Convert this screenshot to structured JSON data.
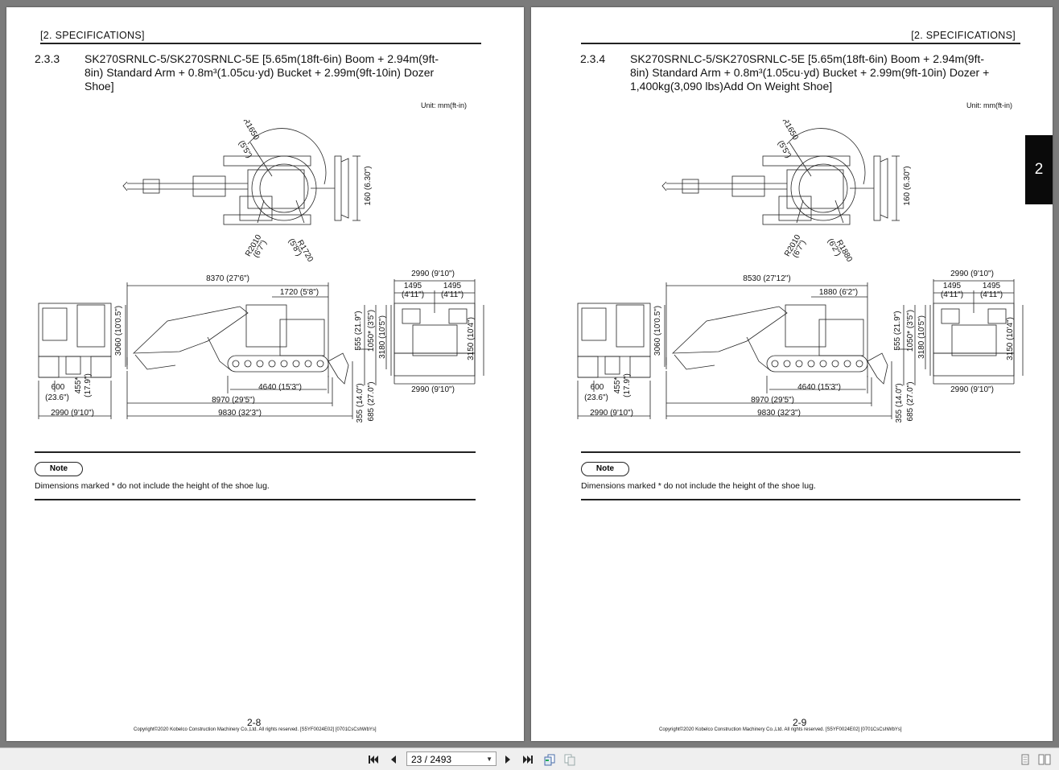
{
  "pages": [
    {
      "header": "[2.   SPECIFICATIONS]",
      "section_number": "2.3.3",
      "title_lines": [
        "SK270SRNLC-5/SK270SRNLC-5E [5.65m(18ft-6in) Boom + 2.94m(9ft-",
        "8in) Standard Arm + 0.8m³(1.05cu·yd) Bucket + 2.99m(9ft-10in) Dozer",
        "Shoe]"
      ],
      "unit": "Unit: mm(ft-in)",
      "dims": {
        "r_top": "R1650",
        "r_top_ft": "(5'5\")",
        "w160": "160 (6.30\")",
        "r_left": "R2010",
        "r_left_ft": "(6'7\")",
        "r_right": "R1720",
        "r_right_ft": "(5'8\")",
        "overall_len": "8370 (27'6\")",
        "tail": "1720 (5'8\")",
        "h3060": "3060 (10'0.5\")",
        "h555": "555 (21.9\")",
        "h1050": "1050* (3'5\")",
        "h3180": "3180 (10'5\")",
        "track_len": "4640 (15'3\")",
        "len8970": "8970 (29'5\")",
        "len9830": "9830 (32'3\")",
        "d355": "355 (14.0\")",
        "d685": "685 (27.0\")",
        "w600": "600",
        "w600_in": "(23.6\")",
        "h455": "455*",
        "h455_in": "(17.9\")",
        "width_bottom": "2990 (9'10\")",
        "rear_width_top": "2990 (9'10\")",
        "w1495a": "1495",
        "w1495a_ft": "(4'11\")",
        "w1495b": "1495",
        "w1495b_ft": "(4'11\")",
        "h3150": "3150 (10'4\")",
        "rear_width_bottom": "2990 (9'10\")"
      },
      "note_label": "Note",
      "note_text": "Dimensions marked * do not include the height of the shoe lug.",
      "page_number": "2-8",
      "copyright": "Copyright©2020 Kobelco Construction Machinery Co.,Ltd. All rights reserved. [S5YF0024E02] [0701CsCshWbYs]"
    },
    {
      "header": "[2.   SPECIFICATIONS]",
      "section_number": "2.3.4",
      "title_lines": [
        "SK270SRNLC-5/SK270SRNLC-5E [5.65m(18ft-6in) Boom + 2.94m(9ft-",
        "8in) Standard Arm + 0.8m³(1.05cu·yd) Bucket + 2.99m(9ft-10in) Dozer +",
        "1,400kg(3,090 lbs)Add On Weight Shoe]"
      ],
      "unit": "Unit: mm(ft-in)",
      "dims": {
        "r_top": "R1650",
        "r_top_ft": "(5'5\")",
        "w160": "160 (6.30\")",
        "r_left": "R2010",
        "r_left_ft": "(6'7\")",
        "r_right": "R1880",
        "r_right_ft": "(6'2\")",
        "overall_len": "8530 (27'12\")",
        "tail": "1880 (6'2\")",
        "h3060": "3060 (10'0.5\")",
        "h555": "555 (21.9\")",
        "h1050": "1050* (3'5\")",
        "h3180": "3180 (10'5\")",
        "track_len": "4640 (15'3\")",
        "len8970": "8970 (29'5\")",
        "len9830": "9830 (32'3\")",
        "d355": "355 (14.0\")",
        "d685": "685 (27.0\")",
        "w600": "600",
        "w600_in": "(23.6\")",
        "h455": "455*",
        "h455_in": "(17.9\")",
        "width_bottom": "2990 (9'10\")",
        "rear_width_top": "2990 (9'10\")",
        "w1495a": "1495",
        "w1495a_ft": "(4'11\")",
        "w1495b": "1495",
        "w1495b_ft": "(4'11\")",
        "h3150": "3150 (10'4\")",
        "rear_width_bottom": "2990 (9'10\")"
      },
      "note_label": "Note",
      "note_text": "Dimensions marked * do not include the height of the shoe lug.",
      "page_number": "2-9",
      "copyright": "Copyright©2020 Kobelco Construction Machinery Co.,Ltd. All rights reserved. [S5YF0024E02] [0701CsCshWbYs]"
    }
  ],
  "chapter_tab": "2",
  "toolbar": {
    "page_indicator": "23 / 2493",
    "icons": [
      "first-page-icon",
      "prev-page-icon",
      "next-page-icon",
      "last-page-icon",
      "prev-view-icon",
      "next-view-icon",
      "single-page-icon",
      "two-page-icon"
    ]
  }
}
